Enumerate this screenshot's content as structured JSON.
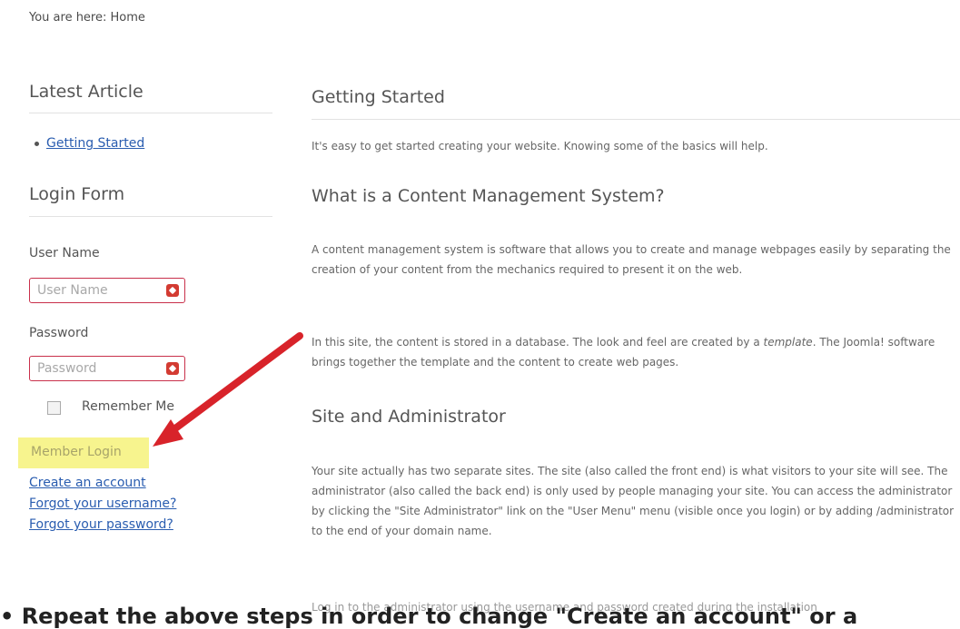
{
  "breadcrumb": "You are here: Home",
  "sidebar": {
    "latest_title": "Latest Article",
    "latest_item": "Getting Started",
    "login_title": "Login Form",
    "username_label": "User Name",
    "username_placeholder": "User Name",
    "password_label": "Password",
    "password_placeholder": "Password",
    "remember_label": "Remember Me",
    "login_button": "Member Login",
    "links": [
      "Create an account",
      "Forgot your username?",
      "Forgot your password?"
    ]
  },
  "main": {
    "title": "Getting Started",
    "intro": "It's easy to get started creating your website. Knowing some of the basics will help.",
    "cms_title": "What is a Content Management System?",
    "cms_p1": "A content management system is software that allows you to create and manage webpages easily by separating the creation of your content from the mechanics required to present it on the web.",
    "cms_p2_a": "In this site, the content is stored in a database. The look and feel are created by a",
    "cms_p2_em": "template",
    "cms_p2_b": ". The Joomla! software brings together the template and the content to create web pages.",
    "site_title": "Site and Administrator",
    "site_p1": "Your site actually has two separate sites. The site (also called the front end) is what visitors to your site will see. The administrator (also called the back end) is only used by people managing your site. You can access the administrator by clicking the \"Site Administrator\" link on the \"User Menu\" menu (visible once you login) or by adding /administrator to the end of your domain name.",
    "site_p2": "Log in to the administrator using the username and password created during the installation"
  },
  "overlay_caption": "• Repeat the above steps in order to change \"Create an account\" or a",
  "colors": {
    "arrow": "#d8232a",
    "highlight": "#f7f48e",
    "link": "#2a5db0",
    "error": "#d33b32"
  }
}
